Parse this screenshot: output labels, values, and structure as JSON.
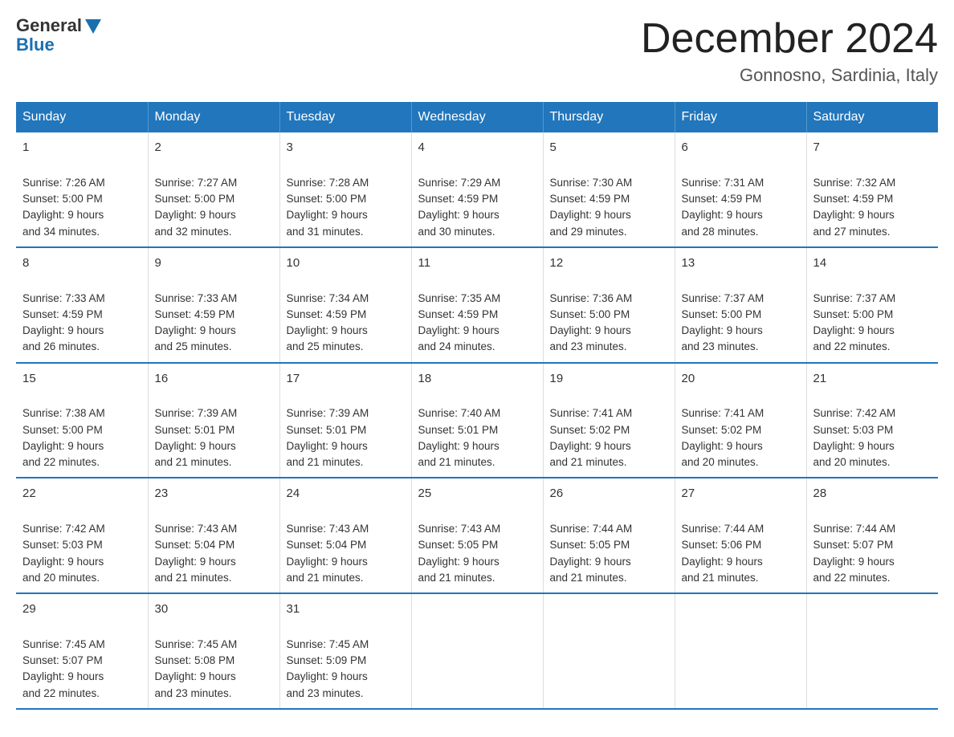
{
  "logo": {
    "general": "General",
    "blue": "Blue"
  },
  "title": "December 2024",
  "location": "Gonnosno, Sardinia, Italy",
  "days": [
    "Sunday",
    "Monday",
    "Tuesday",
    "Wednesday",
    "Thursday",
    "Friday",
    "Saturday"
  ],
  "weeks": [
    [
      {
        "num": "1",
        "sunrise": "7:26 AM",
        "sunset": "5:00 PM",
        "daylight": "9 hours and 34 minutes."
      },
      {
        "num": "2",
        "sunrise": "7:27 AM",
        "sunset": "5:00 PM",
        "daylight": "9 hours and 32 minutes."
      },
      {
        "num": "3",
        "sunrise": "7:28 AM",
        "sunset": "5:00 PM",
        "daylight": "9 hours and 31 minutes."
      },
      {
        "num": "4",
        "sunrise": "7:29 AM",
        "sunset": "4:59 PM",
        "daylight": "9 hours and 30 minutes."
      },
      {
        "num": "5",
        "sunrise": "7:30 AM",
        "sunset": "4:59 PM",
        "daylight": "9 hours and 29 minutes."
      },
      {
        "num": "6",
        "sunrise": "7:31 AM",
        "sunset": "4:59 PM",
        "daylight": "9 hours and 28 minutes."
      },
      {
        "num": "7",
        "sunrise": "7:32 AM",
        "sunset": "4:59 PM",
        "daylight": "9 hours and 27 minutes."
      }
    ],
    [
      {
        "num": "8",
        "sunrise": "7:33 AM",
        "sunset": "4:59 PM",
        "daylight": "9 hours and 26 minutes."
      },
      {
        "num": "9",
        "sunrise": "7:33 AM",
        "sunset": "4:59 PM",
        "daylight": "9 hours and 25 minutes."
      },
      {
        "num": "10",
        "sunrise": "7:34 AM",
        "sunset": "4:59 PM",
        "daylight": "9 hours and 25 minutes."
      },
      {
        "num": "11",
        "sunrise": "7:35 AM",
        "sunset": "4:59 PM",
        "daylight": "9 hours and 24 minutes."
      },
      {
        "num": "12",
        "sunrise": "7:36 AM",
        "sunset": "5:00 PM",
        "daylight": "9 hours and 23 minutes."
      },
      {
        "num": "13",
        "sunrise": "7:37 AM",
        "sunset": "5:00 PM",
        "daylight": "9 hours and 23 minutes."
      },
      {
        "num": "14",
        "sunrise": "7:37 AM",
        "sunset": "5:00 PM",
        "daylight": "9 hours and 22 minutes."
      }
    ],
    [
      {
        "num": "15",
        "sunrise": "7:38 AM",
        "sunset": "5:00 PM",
        "daylight": "9 hours and 22 minutes."
      },
      {
        "num": "16",
        "sunrise": "7:39 AM",
        "sunset": "5:01 PM",
        "daylight": "9 hours and 21 minutes."
      },
      {
        "num": "17",
        "sunrise": "7:39 AM",
        "sunset": "5:01 PM",
        "daylight": "9 hours and 21 minutes."
      },
      {
        "num": "18",
        "sunrise": "7:40 AM",
        "sunset": "5:01 PM",
        "daylight": "9 hours and 21 minutes."
      },
      {
        "num": "19",
        "sunrise": "7:41 AM",
        "sunset": "5:02 PM",
        "daylight": "9 hours and 21 minutes."
      },
      {
        "num": "20",
        "sunrise": "7:41 AM",
        "sunset": "5:02 PM",
        "daylight": "9 hours and 20 minutes."
      },
      {
        "num": "21",
        "sunrise": "7:42 AM",
        "sunset": "5:03 PM",
        "daylight": "9 hours and 20 minutes."
      }
    ],
    [
      {
        "num": "22",
        "sunrise": "7:42 AM",
        "sunset": "5:03 PM",
        "daylight": "9 hours and 20 minutes."
      },
      {
        "num": "23",
        "sunrise": "7:43 AM",
        "sunset": "5:04 PM",
        "daylight": "9 hours and 21 minutes."
      },
      {
        "num": "24",
        "sunrise": "7:43 AM",
        "sunset": "5:04 PM",
        "daylight": "9 hours and 21 minutes."
      },
      {
        "num": "25",
        "sunrise": "7:43 AM",
        "sunset": "5:05 PM",
        "daylight": "9 hours and 21 minutes."
      },
      {
        "num": "26",
        "sunrise": "7:44 AM",
        "sunset": "5:05 PM",
        "daylight": "9 hours and 21 minutes."
      },
      {
        "num": "27",
        "sunrise": "7:44 AM",
        "sunset": "5:06 PM",
        "daylight": "9 hours and 21 minutes."
      },
      {
        "num": "28",
        "sunrise": "7:44 AM",
        "sunset": "5:07 PM",
        "daylight": "9 hours and 22 minutes."
      }
    ],
    [
      {
        "num": "29",
        "sunrise": "7:45 AM",
        "sunset": "5:07 PM",
        "daylight": "9 hours and 22 minutes."
      },
      {
        "num": "30",
        "sunrise": "7:45 AM",
        "sunset": "5:08 PM",
        "daylight": "9 hours and 23 minutes."
      },
      {
        "num": "31",
        "sunrise": "7:45 AM",
        "sunset": "5:09 PM",
        "daylight": "9 hours and 23 minutes."
      },
      {
        "num": "",
        "sunrise": "",
        "sunset": "",
        "daylight": ""
      },
      {
        "num": "",
        "sunrise": "",
        "sunset": "",
        "daylight": ""
      },
      {
        "num": "",
        "sunrise": "",
        "sunset": "",
        "daylight": ""
      },
      {
        "num": "",
        "sunrise": "",
        "sunset": "",
        "daylight": ""
      }
    ]
  ]
}
